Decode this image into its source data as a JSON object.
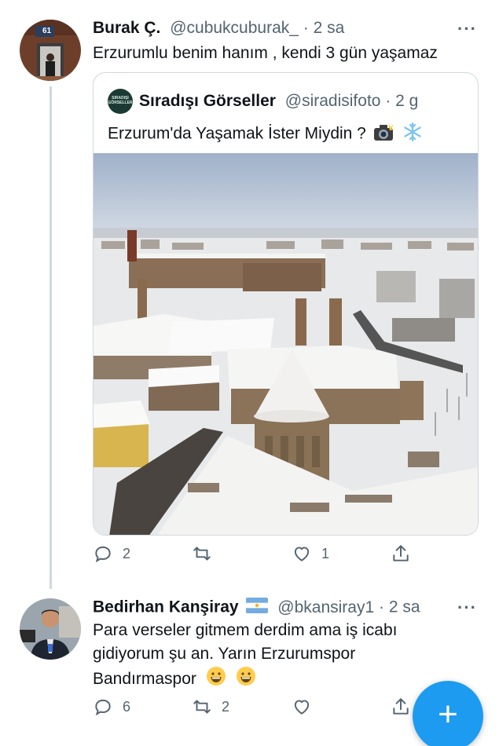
{
  "tweets": [
    {
      "name": "Burak Ç.",
      "handle": "@cubukcuburak_",
      "separator": "·",
      "time": "2 sa",
      "text": "Erzurumlu benim hanım , kendi 3 gün yaşamaz",
      "avatar_label": "61",
      "more": "···",
      "quote": {
        "logo_text": "SIRADIŞI GÖRSELLER",
        "name": "Sıradışı Görseller",
        "handle": "@siradisifoto",
        "separator": "·",
        "time": "2 g",
        "text": "Erzurum'da Yaşamak İster Miydin ?",
        "emojis": [
          "camera-flash-emoji",
          "snowflake-emoji"
        ]
      },
      "actions": {
        "reply": "2",
        "retweet": "",
        "like": "1",
        "share": ""
      }
    },
    {
      "name": "Bedirhan Kanşiray",
      "flag": "argentina-flag-icon",
      "handle": "@bkansiray1",
      "separator": "·",
      "time": "2 sa",
      "text_lines": [
        "Para verseler gitmem derdim ama iş icabı",
        "gidiyorum şu an. Yarın Erzurumspor",
        "Bandırmaspor"
      ],
      "emojis": [
        "grinning-face-emoji",
        "grinning-face-emoji"
      ],
      "more": "···",
      "actions": {
        "reply": "6",
        "retweet": "2",
        "like": "",
        "share": ""
      }
    }
  ],
  "fab": {
    "label": "+"
  },
  "colors": {
    "accent": "#1d9bf0",
    "text": "#0f1419",
    "secondary": "#536471",
    "border": "#cfd9de"
  }
}
